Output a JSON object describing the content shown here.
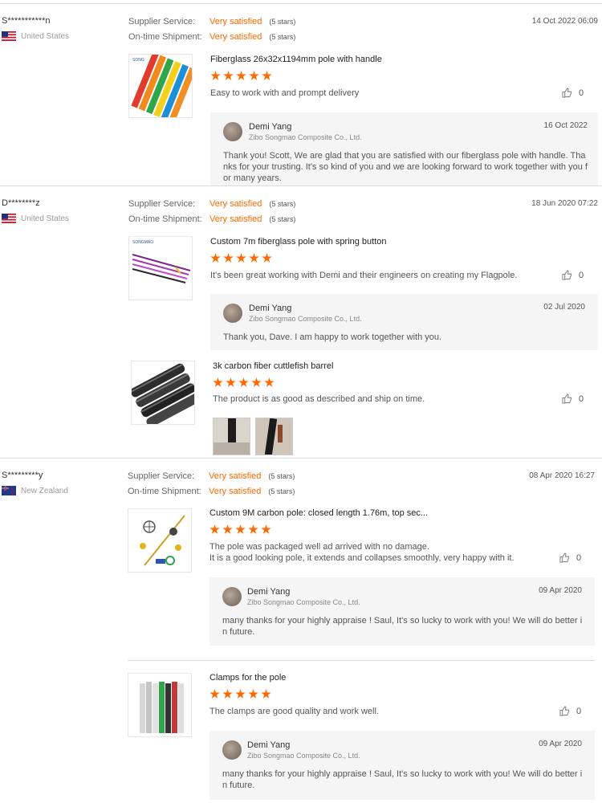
{
  "labels": {
    "supplier_service": "Supplier Service:",
    "ontime_shipment": "On-time Shipment:"
  },
  "reviews": [
    {
      "buyer": "S***********n",
      "country": "United States",
      "date": "14 Oct 2022 06:09",
      "supplier_rating": "Very satisfied",
      "supplier_stars": "(5 stars)",
      "shipment_rating": "Very satisfied",
      "shipment_stars": "(5 stars)",
      "products": [
        {
          "name": "Fiberglass 26x32x1194mm pole with handle",
          "stars": 5,
          "text": "Easy to work with and prompt delivery",
          "likes": "0",
          "reply": {
            "name": "Demi Yang",
            "company": "Zibo Songmao Composite Co., Ltd.",
            "date": "16 Oct 2022",
            "text": "Thank you! Scott, We are glad that you are satisfied with our fiberglass pole with handle.  Thanks for  your trusting. It's so kind of you and we are looking forward to work together with you for many years."
          }
        }
      ]
    },
    {
      "buyer": "D********z",
      "country": "United States",
      "date": "18 Jun 2020 07:22",
      "supplier_rating": "Very satisfied",
      "supplier_stars": "(5 stars)",
      "shipment_rating": "Very satisfied",
      "shipment_stars": "(5 stars)",
      "products": [
        {
          "name": "Custom 7m fiberglass pole with spring button",
          "stars": 5,
          "text": "It's been great working with Demi and their engineers on creating my Flagpole.",
          "likes": "0",
          "reply": {
            "name": "Demi Yang",
            "company": "Zibo Songmao Composite Co., Ltd.",
            "date": "02 Jul 2020",
            "text": "Thank you, Dave. I am happy to work together with you."
          }
        },
        {
          "name": "3k carbon fiber cuttlefish barrel",
          "stars": 5,
          "text": "The product is as good as described and ship on time.",
          "likes": "0"
        }
      ]
    },
    {
      "buyer": "S*********y",
      "country": "New Zealand",
      "date": "08 Apr 2020 16:27",
      "supplier_rating": "Very satisfied",
      "supplier_stars": "(5 stars)",
      "shipment_rating": "Very satisfied",
      "shipment_stars": "(5 stars)",
      "products": [
        {
          "name": "Custom 9M carbon pole: closed length 1.76m, top sec...",
          "stars": 5,
          "text_line1": "The pole was packaged well ad arrived with no damage.",
          "text_line2": "It is a good looking pole, it extends and collapses smoothly, very happy with it.",
          "likes": "0",
          "reply": {
            "name": "Demi Yang",
            "company": "Zibo Songmao Composite Co., Ltd.",
            "date": "09 Apr 2020",
            "text": "many thanks for your highly appraise ! Saul, It's so lucky to work with you! We will do better in future."
          }
        },
        {
          "name": "Clamps for the pole",
          "stars": 5,
          "text": "The clamps are good quality and work well.",
          "likes": "0",
          "reply": {
            "name": "Demi Yang",
            "company": "Zibo Songmao Composite Co., Ltd.",
            "date": "09 Apr 2020",
            "text": "many thanks for your highly appraise ! Saul, It's so lucky to work with you! We will do better in future."
          }
        }
      ]
    }
  ],
  "colors": {
    "accent": "#ff6a00",
    "reply_bg": "#f5f5f5",
    "divider": "#dcdcdc"
  },
  "icons": {
    "like": "thumbs-up-icon",
    "flag_us": "us-flag-icon",
    "flag_nz": "nz-flag-icon",
    "avatar": "avatar"
  }
}
